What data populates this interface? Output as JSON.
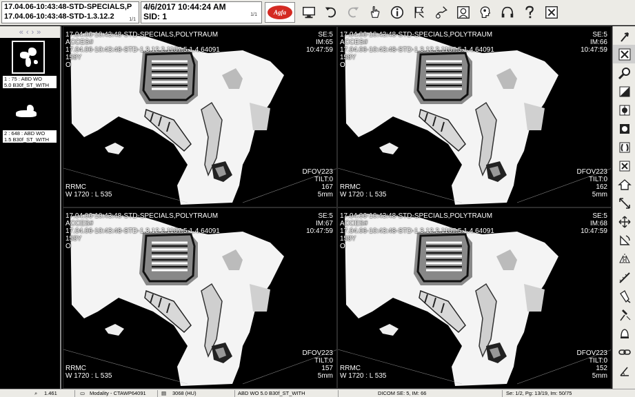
{
  "header": {
    "study_line1": "17.04.06-10:43:48-STD-SPECIALS,P",
    "study_line2": "17.04.06-10:43:48-STD-1.3.12.2",
    "study_pages": "1/1",
    "date_time": "4/6/2017  10:44:24 AM",
    "sid": "SID: 1",
    "date_pages": "1/1",
    "logo_text": "Agfa"
  },
  "toolbar": [
    {
      "name": "monitor-icon"
    },
    {
      "name": "undo-icon"
    },
    {
      "name": "redo-icon"
    },
    {
      "name": "hand-pointer-icon"
    },
    {
      "name": "info-icon"
    },
    {
      "name": "flag-icon"
    },
    {
      "name": "annotate-hand-icon"
    },
    {
      "name": "portrait-icon"
    },
    {
      "name": "head-profile-icon"
    },
    {
      "name": "headphones-icon"
    },
    {
      "name": "help-icon"
    },
    {
      "name": "close-window-icon"
    }
  ],
  "thumbnails": {
    "nav": [
      "«",
      "‹",
      "›",
      "»"
    ],
    "items": [
      {
        "caption1": "1 : 75 : ABD WO",
        "caption2": "5.0  B30f_ST_WITH"
      },
      {
        "caption1": "2 : 648 : ABD WO",
        "caption2": "1.5  B30f_ST_WITH"
      }
    ]
  },
  "tiles": [
    {
      "tl": [
        "17.04.06-10:43:48-STD-SPECIALS,POLYTRAUM",
        "ACCES#",
        "17.04.06-10:43:48-STD-1.3.12.2.1107.5.1.4.64091",
        "158Y",
        "O"
      ],
      "tr": [
        "SE:5",
        "IM:65",
        "10:47:59"
      ],
      "bl": [
        "RRMC",
        "W 1720 : L 535"
      ],
      "br": [
        "DFOV223",
        "TILT:0",
        "167",
        "5mm"
      ]
    },
    {
      "tl": [
        "17.04.06-10:43:48-STD-SPECIALS,POLYTRAUM",
        "ACCES#",
        "17.04.06-10:43:48-STD-1.3.12.2.1107.5.1.4.64091",
        "158Y",
        "O"
      ],
      "tr": [
        "SE:5",
        "IM:66",
        "10:47:59"
      ],
      "bl": [
        "RRMC",
        "W 1720 : L 535"
      ],
      "br": [
        "DFOV223",
        "TILT:0",
        "162",
        "5mm"
      ]
    },
    {
      "tl": [
        "17.04.06-10:43:48-STD-SPECIALS,POLYTRAUM",
        "ACCES#",
        "17.04.06-10:43:48-STD-1.3.12.2.1107.5.1.4.64091",
        "158Y",
        "O"
      ],
      "tr": [
        "SE:5",
        "IM:67",
        "10:47:59"
      ],
      "bl": [
        "RRMC",
        "W 1720 : L 535"
      ],
      "br": [
        "DFOV223",
        "TILT:0",
        "157",
        "5mm"
      ]
    },
    {
      "tl": [
        "17.04.06-10:43:48-STD-SPECIALS,POLYTRAUM",
        "ACCES#",
        "17.04.06-10:43:48-STD-1.3.12.2.1107.5.1.4.64091",
        "158Y",
        "O"
      ],
      "tr": [
        "SE:5",
        "IM:68",
        "10:47:59"
      ],
      "bl": [
        "RRMC",
        "W 1720 : L 535"
      ],
      "br": [
        "DFOV223",
        "TILT:0",
        "152",
        "5mm"
      ]
    }
  ],
  "right_tools": [
    {
      "name": "scroll-arrow-icon"
    },
    {
      "name": "zoom-fit-icon"
    },
    {
      "name": "magnifier-icon"
    },
    {
      "name": "window-level-icon"
    },
    {
      "name": "contrast-icon"
    },
    {
      "name": "invert-icon"
    },
    {
      "name": "lung-window-icon"
    },
    {
      "name": "bone-window-icon"
    },
    {
      "name": "home-window-icon"
    },
    {
      "name": "resize-icon"
    },
    {
      "name": "pan-icon"
    },
    {
      "name": "rotate-icon"
    },
    {
      "name": "flip-icon"
    },
    {
      "name": "measure-icon"
    },
    {
      "name": "syringe-icon"
    },
    {
      "name": "probe-icon"
    },
    {
      "name": "bell-icon"
    },
    {
      "name": "link-icon"
    },
    {
      "name": "angle-icon"
    }
  ],
  "status": {
    "zoom": "1.461",
    "modality": "Modality - CTAWP64091",
    "hu": "3068 (HU)",
    "series": "ABD WO  5.0  B30f_ST_WITH",
    "dicom": "DICOM  SE: 5, IM: 66",
    "paging": "Se: 1/2,  Pg: 13/19,  Im: 50/75"
  }
}
